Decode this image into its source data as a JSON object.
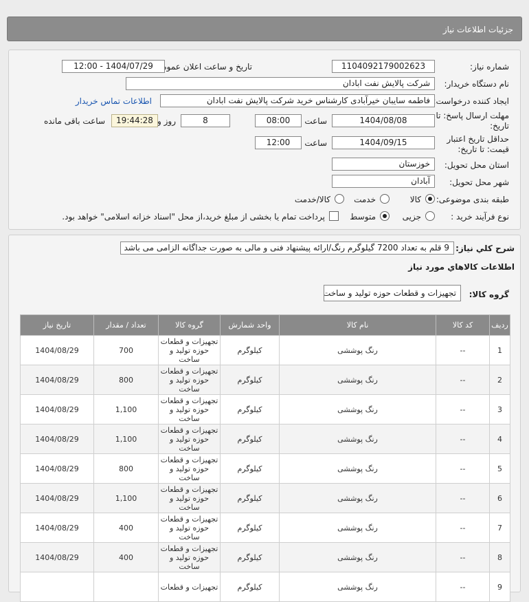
{
  "header": {
    "title": "جزئیات اطلاعات نیاز"
  },
  "form": {
    "need_number_label": "شماره نیاز:",
    "need_number": "1104092179002623",
    "announce_label": "تاریخ و ساعت اعلان عمومی:",
    "announce_value": "1404/07/29 - 12:00",
    "buyer_label": "نام دستگاه خریدار:",
    "buyer_value": "شرکت پالایش نفت ابادان",
    "creator_label": "ایجاد کننده درخواست:",
    "creator_value": "فاطمه سایبان خیرآبادی کارشناس خرید شرکت پالایش نفت ابادان",
    "contact_link": "اطلاعات تماس خریدار",
    "deadline_label_1": "مهلت ارسال پاسخ: تا",
    "deadline_label_2": "تاریخ:",
    "deadline_date": "1404/08/08",
    "time_label": "ساعت",
    "deadline_time": "08:00",
    "days_value": "8",
    "days_label": "روز و",
    "timer_value": "19:44:28",
    "remaining_label": "ساعت باقی مانده",
    "validity_label_1": "حداقل تاریخ اعتبار",
    "validity_label_2": "قیمت: تا تاریخ:",
    "validity_date": "1404/09/15",
    "validity_time": "12:00",
    "province_label": "استان محل تحویل:",
    "province_value": "خوزستان",
    "city_label": "شهر محل تحویل:",
    "city_value": "آبادان",
    "category_label": "طبقه بندی موضوعی:",
    "category_options": [
      "کالا",
      "خدمت",
      "کالا/خدمت"
    ],
    "process_label": "نوع فرآیند خرید :",
    "process_options": [
      "جزیی",
      "متوسط"
    ],
    "payment_note": "پرداخت تمام یا بخشی از مبلغ خرید،از محل \"اسناد خزانه اسلامی\" خواهد بود."
  },
  "description": {
    "label": "شرح کلي نياز:",
    "value": "9 قلم به تعداد 7200 گیلوگرم رنگ/ارائه پیشنهاد فنی و مالی به صورت جداگانه الزامی می باشد"
  },
  "goods": {
    "section_title": "اطلاعات کالاهاي مورد نياز",
    "group_label": "گروه کالا:",
    "group_value": "تجهیزات و قطعات حوزه تولید و ساخت",
    "columns": [
      "ردیف",
      "کد کالا",
      "نام کالا",
      "واحد شمارش",
      "گروه کالا",
      "تعداد / مقدار",
      "تاریخ نیاز"
    ],
    "rows": [
      {
        "idx": "1",
        "code": "--",
        "name": "رنگ پوششی",
        "unit": "کیلوگرم",
        "group": "تجهیزات و قطعات حوزه تولید و ساخت",
        "qty": "700",
        "date": "1404/08/29"
      },
      {
        "idx": "2",
        "code": "--",
        "name": "رنگ پوششی",
        "unit": "کیلوگرم",
        "group": "تجهیزات و قطعات حوزه تولید و ساخت",
        "qty": "800",
        "date": "1404/08/29"
      },
      {
        "idx": "3",
        "code": "--",
        "name": "رنگ پوششی",
        "unit": "کیلوگرم",
        "group": "تجهیزات و قطعات حوزه تولید و ساخت",
        "qty": "1,100",
        "date": "1404/08/29"
      },
      {
        "idx": "4",
        "code": "--",
        "name": "رنگ پوششی",
        "unit": "کیلوگرم",
        "group": "تجهیزات و قطعات حوزه تولید و ساخت",
        "qty": "1,100",
        "date": "1404/08/29"
      },
      {
        "idx": "5",
        "code": "--",
        "name": "رنگ پوششی",
        "unit": "کیلوگرم",
        "group": "تجهیزات و قطعات حوزه تولید و ساخت",
        "qty": "800",
        "date": "1404/08/29"
      },
      {
        "idx": "6",
        "code": "--",
        "name": "رنگ پوششی",
        "unit": "کیلوگرم",
        "group": "تجهیزات و قطعات حوزه تولید و ساخت",
        "qty": "1,100",
        "date": "1404/08/29"
      },
      {
        "idx": "7",
        "code": "--",
        "name": "رنگ پوششی",
        "unit": "کیلوگرم",
        "group": "تجهیزات و قطعات حوزه تولید و ساخت",
        "qty": "400",
        "date": "1404/08/29"
      },
      {
        "idx": "8",
        "code": "--",
        "name": "رنگ پوششی",
        "unit": "کیلوگرم",
        "group": "تجهیزات و قطعات حوزه تولید و ساخت",
        "qty": "400",
        "date": "1404/08/29"
      },
      {
        "idx": "9",
        "code": "--",
        "name": "رنگ پوششی",
        "unit": "کیلوگرم",
        "group": "تجهیزات و قطعات",
        "qty": "",
        "date": ""
      }
    ]
  }
}
